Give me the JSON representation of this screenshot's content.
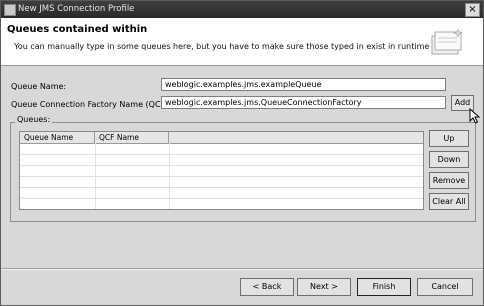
{
  "window": {
    "title": "New JMS Connection Profile"
  },
  "header": {
    "title": "Queues contained within",
    "description": "You can manually type in some queues here, but you have to make sure those typed in exist in runtime"
  },
  "form": {
    "queue_name_label": "Queue Name:",
    "queue_name_value": "weblogic.examples.jms.exampleQueue",
    "qcf_label": "Queue Connection Factory Name (QCF):",
    "qcf_value": "weblogic.examples.jms.QueueConnectionFactory",
    "add_button": "Add"
  },
  "queues": {
    "group_label": "Queues:",
    "columns": [
      "Queue Name",
      "QCF Name"
    ],
    "buttons": {
      "up": "Up",
      "down": "Down",
      "remove": "Remove",
      "clear_all": "Clear All"
    }
  },
  "footer": {
    "back": "< Back",
    "next": "Next >",
    "finish": "Finish",
    "cancel": "Cancel"
  }
}
